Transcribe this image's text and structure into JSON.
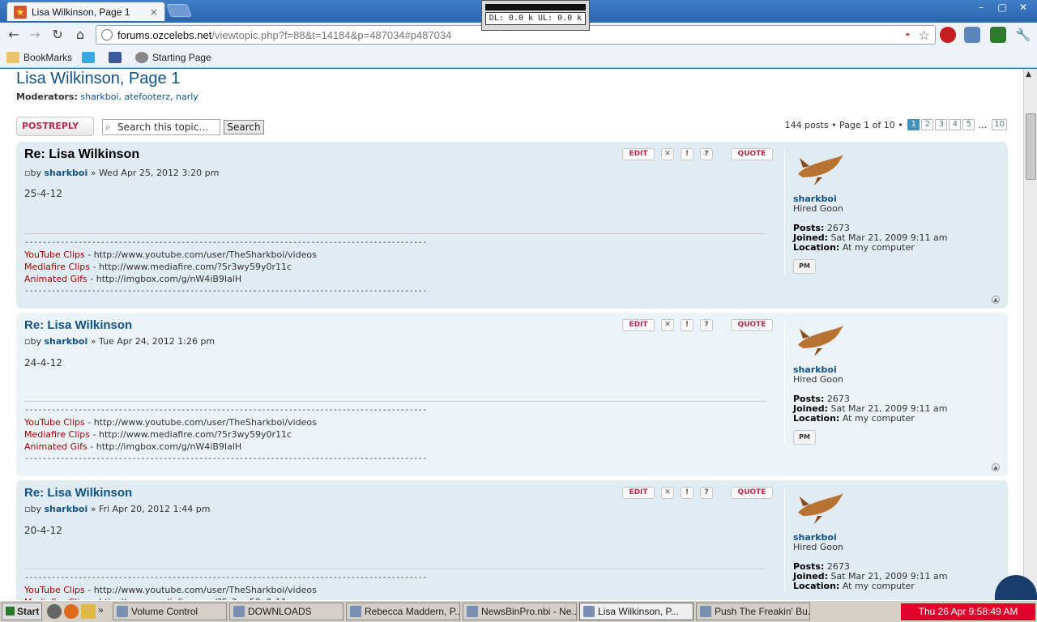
{
  "browser": {
    "tab_title": "Lisa Wilkinson, Page 1",
    "tab_close": "×",
    "url_host": "forums.ozcelebs.net",
    "url_rest": "/viewtopic.php?f=88&t=14184&p=487034#p487034",
    "net_meter": "DL: 0.0 k  UL: 0.0 k",
    "window_controls": [
      "–",
      "▢",
      "✕"
    ],
    "bookmarks": [
      "BookMarks",
      "",
      "",
      "Starting Page"
    ]
  },
  "topic": {
    "title": "Lisa Wilkinson, Page 1",
    "moderators_label": "Moderators:",
    "moderators": "sharkboi, atefooterz, narly",
    "postreply": "POSTREPLY",
    "search_placeholder": "Search this topic…",
    "search_button": "Search",
    "post_count": "144 posts • Page 1 of 10 •",
    "pages": [
      "1",
      "2",
      "3",
      "4",
      "5",
      "…",
      "10"
    ]
  },
  "posts": [
    {
      "title": "Re: Lisa Wilkinson",
      "by": "by",
      "author": "sharkboi",
      "date": "» Wed Apr 25, 2012 3:20 pm",
      "body": "25-4-12"
    },
    {
      "title": "Re: Lisa Wilkinson",
      "by": "by",
      "author": "sharkboi",
      "date": "» Tue Apr 24, 2012 1:26 pm",
      "body": "24-4-12"
    },
    {
      "title": "Re: Lisa Wilkinson",
      "by": "by",
      "author": "sharkboi",
      "date": "» Fri Apr 20, 2012 1:44 pm",
      "body": "20-4-12"
    }
  ],
  "signature": {
    "dashes": "------------------------------------------------------------------------------------------",
    "lines": [
      {
        "label": "YouTube Clips",
        "url": " - http://www.youtube.com/user/TheSharkboi/videos"
      },
      {
        "label": "Mediafire Clips",
        "url": " - http://www.mediafire.com/?5r3wy59y0r11c"
      },
      {
        "label": "Animated Gifs",
        "url": " - http://imgbox.com/g/nW4iB9IalH"
      }
    ]
  },
  "buttons": {
    "edit": "EDIT",
    "delete": "✕",
    "report": "!",
    "info": "?",
    "quote": "QUOTE",
    "pm": "PM"
  },
  "profile": {
    "name": "sharkboi",
    "rank": "Hired Goon",
    "posts_label": "Posts:",
    "posts": "2673",
    "joined_label": "Joined:",
    "joined": "Sat Mar 21, 2009 9:11 am",
    "location_label": "Location:",
    "location": "At my computer"
  },
  "taskbar": {
    "start": "Start",
    "tasks": [
      "Volume Control",
      "DOWNLOADS",
      "Rebecca Maddern, P...",
      "NewsBinPro.nbi - Ne...",
      "Lisa Wilkinson, P...",
      "Push The Freakin' Bu..."
    ],
    "clock": "Thu 26 Apr 9:58:49 AM"
  }
}
